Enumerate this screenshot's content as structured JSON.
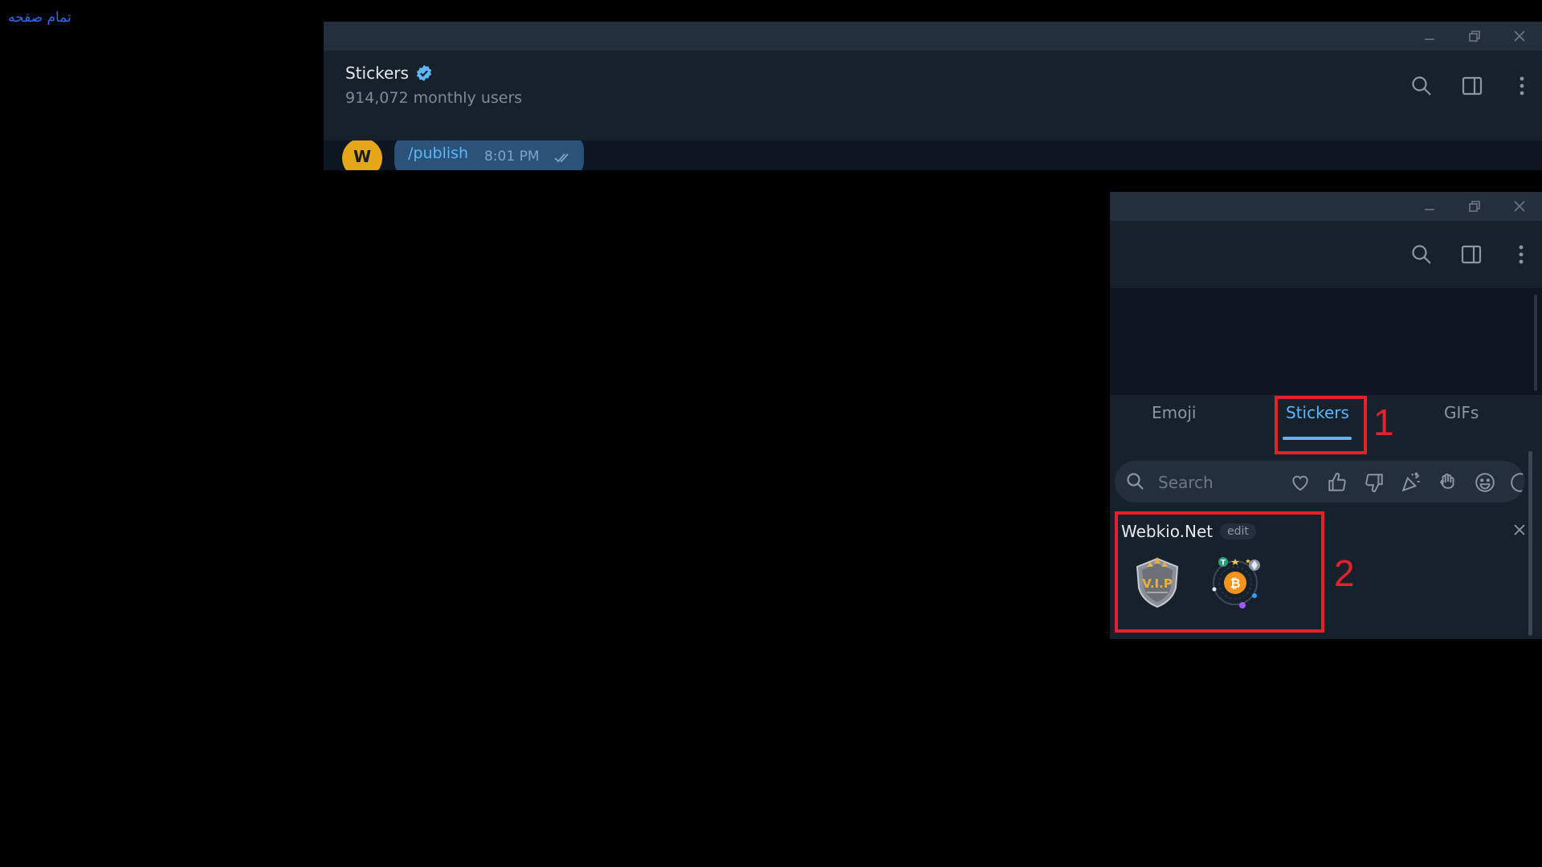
{
  "page": {
    "fullpage_link": "تمام صفحه"
  },
  "window1": {
    "channel_title": "Stickers",
    "channel_subtitle": "914,072 monthly users",
    "message_text": "/publish",
    "message_time": "8:01 PM",
    "avatar_letter": "W"
  },
  "window2": {
    "tabs": [
      "Emoji",
      "Stickers",
      "GIFs"
    ],
    "active_tab": "Stickers",
    "search_placeholder": "Search",
    "emoji_filters": [
      "heart-icon",
      "thumbs-up-icon",
      "thumbs-down-icon",
      "party-popper-icon",
      "waving-hand-icon",
      "smile-icon",
      "more-emoji-icon"
    ],
    "sticker_set_title": "Webkio.Net",
    "edit_label": "edit",
    "stickers": [
      "vip-shield-sticker",
      "bitcoin-orbit-sticker"
    ]
  },
  "annotations": {
    "box1_label": "1",
    "box2_label": "2"
  },
  "colors": {
    "accent": "#5eb5f7",
    "annotation": "#e4222e",
    "link": "#2f6df0"
  }
}
